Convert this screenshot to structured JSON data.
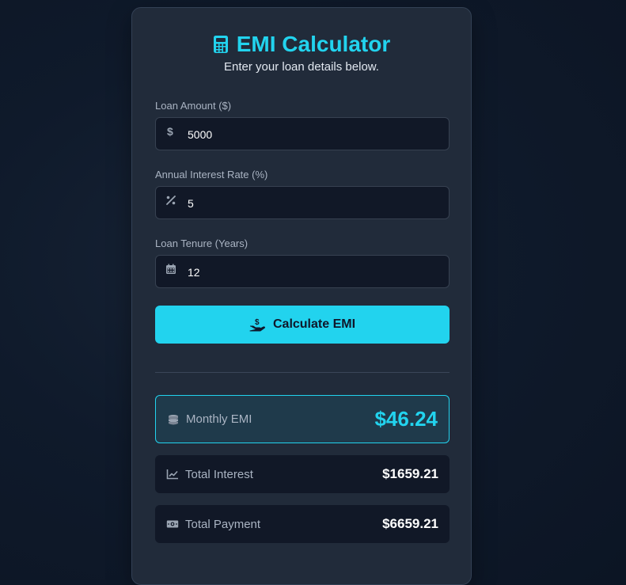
{
  "header": {
    "title": "EMI Calculator",
    "subtitle": "Enter your loan details below.",
    "icon": "calculator-icon"
  },
  "form": {
    "loan_amount": {
      "label": "Loan Amount ($)",
      "value": "5000",
      "icon": "dollar-icon"
    },
    "interest_rate": {
      "label": "Annual Interest Rate (%)",
      "value": "5",
      "icon": "percent-icon"
    },
    "tenure": {
      "label": "Loan Tenure (Years)",
      "value": "12",
      "icon": "calendar-icon"
    },
    "calculate_label": "Calculate EMI",
    "calculate_icon": "hand-dollar-icon"
  },
  "results": {
    "monthly_emi": {
      "label": "Monthly EMI",
      "value": "$46.24",
      "icon": "coins-icon"
    },
    "total_interest": {
      "label": "Total Interest",
      "value": "$1659.21",
      "icon": "line-chart-icon"
    },
    "total_payment": {
      "label": "Total Payment",
      "value": "$6659.21",
      "icon": "money-bill-icon"
    }
  },
  "colors": {
    "accent": "#22d3ee",
    "card_bg": "#212b3a",
    "input_bg": "#111827",
    "page_bg": "#0f1a2b"
  }
}
